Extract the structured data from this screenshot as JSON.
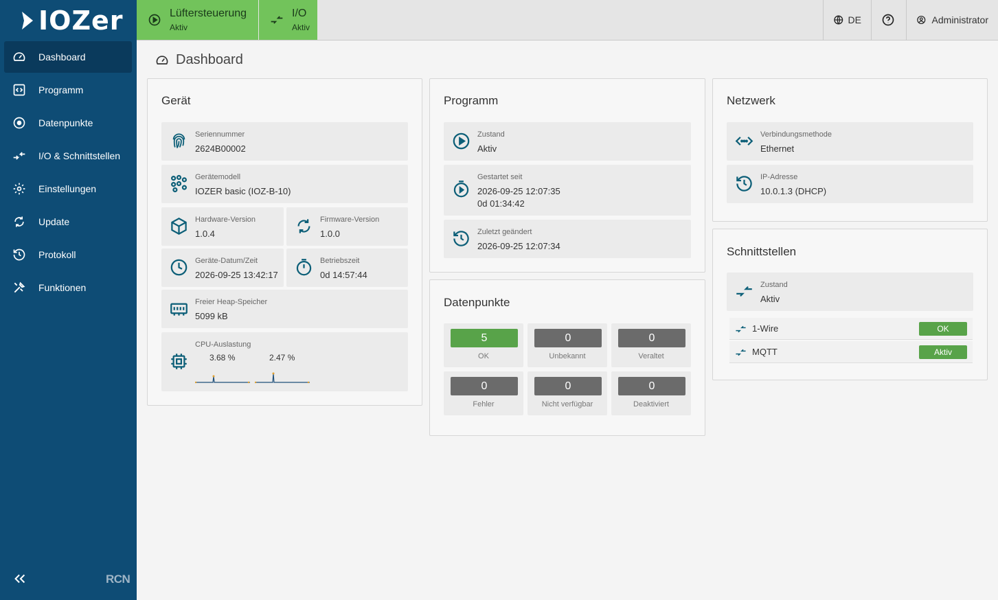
{
  "brand": {
    "logo_text": "IOZer",
    "footer_logo": "RCN"
  },
  "colors": {
    "sidebar": "#0e4c75",
    "active": "#72c35b",
    "ok": "#58a349",
    "neutral": "#6b6b6b",
    "icon": "#0d5f78"
  },
  "sidebar": {
    "items": [
      {
        "label": "Dashboard",
        "icon": "dashboard-icon",
        "active": true
      },
      {
        "label": "Programm",
        "icon": "code-icon"
      },
      {
        "label": "Datenpunkte",
        "icon": "target-icon"
      },
      {
        "label": "I/O & Schnittstellen",
        "icon": "arrows-in-icon"
      },
      {
        "label": "Einstellungen",
        "icon": "gear-icon"
      },
      {
        "label": "Update",
        "icon": "refresh-icon"
      },
      {
        "label": "Protokoll",
        "icon": "history-icon"
      },
      {
        "label": "Funktionen",
        "icon": "tools-icon"
      }
    ]
  },
  "topbar": {
    "tabs": [
      {
        "title": "Lüftersteuerung",
        "status": "Aktiv",
        "icon": "play-icon"
      },
      {
        "title": "I/O",
        "status": "Aktiv",
        "icon": "arrows-in-icon"
      }
    ],
    "language": "DE",
    "user": "Administrator"
  },
  "page": {
    "title": "Dashboard"
  },
  "device": {
    "title": "Gerät",
    "serial_label": "Seriennummer",
    "serial": "2624B00002",
    "model_label": "Gerätemodell",
    "model": "IOZER basic (IOZ-B-10)",
    "hw_label": "Hardware-Version",
    "hw": "1.0.4",
    "fw_label": "Firmware-Version",
    "fw": "1.0.0",
    "datetime_label": "Geräte-Datum/Zeit",
    "datetime": "2026-09-25 13:42:17",
    "uptime_label": "Betriebszeit",
    "uptime": "0d 14:57:44",
    "heap_label": "Freier Heap-Speicher",
    "heap": "5099 kB",
    "cpu_label": "CPU-Auslastung",
    "cpu1": "3.68 %",
    "cpu2": "2.47 %"
  },
  "program": {
    "title": "Programm",
    "state_label": "Zustand",
    "state": "Aktiv",
    "started_label": "Gestartet seit",
    "started": "2026-09-25 12:07:35",
    "started_elapsed": "0d 01:34:42",
    "changed_label": "Zuletzt geändert",
    "changed": "2026-09-25 12:07:34"
  },
  "datapoints": {
    "title": "Datenpunkte",
    "items": [
      {
        "value": "5",
        "label": "OK"
      },
      {
        "value": "0",
        "label": "Unbekannt"
      },
      {
        "value": "0",
        "label": "Veraltet"
      },
      {
        "value": "0",
        "label": "Fehler"
      },
      {
        "value": "0",
        "label": "Nicht verfügbar"
      },
      {
        "value": "0",
        "label": "Deaktiviert"
      }
    ]
  },
  "network": {
    "title": "Netzwerk",
    "method_label": "Verbindungsmethode",
    "method": "Ethernet",
    "ip_label": "IP-Adresse",
    "ip": "10.0.1.3 (DHCP)"
  },
  "interfaces": {
    "title": "Schnittstellen",
    "state_label": "Zustand",
    "state": "Aktiv",
    "items": [
      {
        "name": "1-Wire",
        "status": "OK"
      },
      {
        "name": "MQTT",
        "status": "Aktiv"
      }
    ]
  }
}
